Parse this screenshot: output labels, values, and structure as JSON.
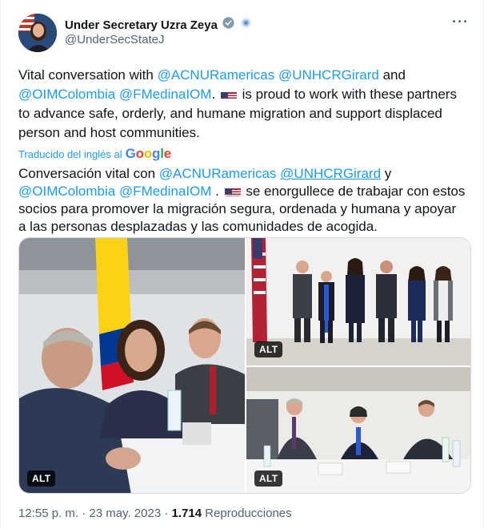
{
  "author": {
    "display_name": "Under Secretary Uzra Zeya",
    "handle": "@UnderSecStateJ",
    "verified_icon": "verified-badge-icon",
    "affiliation_icon": "government-affiliation-icon"
  },
  "tweet": {
    "text_parts": {
      "p1": "Vital conversation with ",
      "m1": "@ACNURamericas",
      "p2": " ",
      "m2": "@UNHCRGirard",
      "p3": " and",
      "m3": "@OIMColombia",
      "p4": " ",
      "m4": "@FMedinaIOM",
      "p5": ". ",
      "p6": " is proud to work with these partners to advance safe, orderly, and humane migration and support displaced person and host communities."
    },
    "translated_label": "Traducido del inglés al",
    "translation_provider": "Google",
    "translation_parts": {
      "p1": "Conversación vital con ",
      "m1": "@ACNURamericas",
      "p2": " ",
      "m2": "@UNHCRGirard",
      "p3": " y",
      "m3": "@OIMColombia",
      "p4": " ",
      "m4": "@FMedinaIOM",
      "p5": " . ",
      "p6": " se enorgullece de trabajar con estos socios para promover la migración segura, ordenada y humana y apoyar a las personas desplazadas y las comunidades de acogida."
    }
  },
  "media": {
    "alt_label": "ALT",
    "photos": [
      {
        "name": "meeting-photo-main"
      },
      {
        "name": "group-photo"
      },
      {
        "name": "meeting-photo-table"
      }
    ]
  },
  "footer": {
    "time": "12:55 p. m.",
    "separator": " · ",
    "date": "23 may. 2023",
    "views_count": "1.714",
    "views_label": " Reproducciones"
  },
  "colors": {
    "link": "#1d9bf0",
    "text": "#0f1419",
    "muted": "#536471"
  }
}
